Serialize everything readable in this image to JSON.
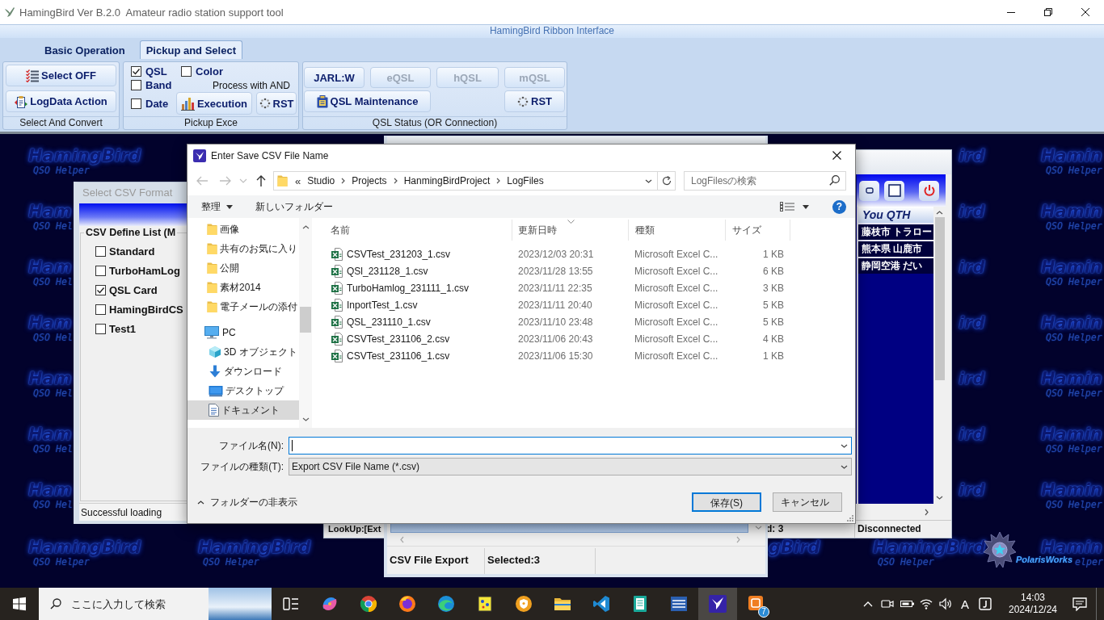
{
  "app_window": {
    "title": "HamingBird Ver B.2.0  Amateur radio station support tool"
  },
  "ribbon": {
    "caption": "HamingBird Ribbon Interface",
    "tabs": [
      {
        "label": "Basic Operation",
        "selected": false
      },
      {
        "label": "Pickup and Select",
        "selected": true
      }
    ],
    "groups": [
      {
        "label": "Select And Convert",
        "buttons": [
          {
            "label": "Select OFF"
          },
          {
            "label": "LogData Action"
          }
        ]
      },
      {
        "label": "Pickup Exce",
        "checkboxes": [
          {
            "label": "QSL",
            "checked": true
          },
          {
            "label": "Band",
            "checked": false
          },
          {
            "label": "Date",
            "checked": false
          },
          {
            "label": "Color",
            "checked": false
          }
        ],
        "note": "Process with AND",
        "buttons": [
          {
            "label": "Execution"
          },
          {
            "label": "RST"
          }
        ]
      },
      {
        "label": "QSL Status (OR Connection)",
        "buttons": [
          {
            "label": "JARL:W",
            "disabled": false
          },
          {
            "label": "eQSL",
            "disabled": true
          },
          {
            "label": "hQSL",
            "disabled": true
          },
          {
            "label": "mQSL",
            "disabled": true
          },
          {
            "label": "QSL Maintenance",
            "disabled": false
          },
          {
            "label": "RST",
            "disabled": false
          }
        ]
      }
    ]
  },
  "desktop": {
    "tiles": [
      {
        "title": "HamingBird",
        "subtitle": "QSO Helper"
      },
      {
        "title": "ird"
      },
      {
        "title": "Hamin",
        "subtitle": "QSO Helper"
      },
      {
        "title": "Ham",
        "subtitle": "QSO Hel"
      },
      {
        "title": "ird"
      },
      {
        "title": "Hamin",
        "subtitle": "QSO Helper"
      },
      {
        "title": "Ham",
        "subtitle": "QSO Hel"
      },
      {
        "title": "ird"
      },
      {
        "title": "Hamin",
        "subtitle": "QSO Helper"
      },
      {
        "title": "Ham",
        "subtitle": "QSO Hel"
      },
      {
        "title": "ird"
      },
      {
        "title": "Hamin",
        "subtitle": "QSO Helper"
      },
      {
        "title": "Ham",
        "subtitle": "QSO Hel"
      },
      {
        "title": "ird"
      },
      {
        "title": "Hamin",
        "subtitle": "QSO Helper"
      },
      {
        "title": "Ham",
        "subtitle": "QSO Hel"
      },
      {
        "title": "ird"
      },
      {
        "title": "Hamin",
        "subtitle": "QSO Helper"
      },
      {
        "title": "Ham",
        "subtitle": "QSO Hel"
      },
      {
        "title": "ird"
      },
      {
        "title": "Hamin",
        "subtitle": "QSO Helper"
      },
      {
        "title": "HamingBird",
        "subtitle": "QSO Helper"
      },
      {
        "title": "HamingBird",
        "subtitle": "QSO Helper"
      },
      {
        "title": "gBird"
      },
      {
        "title": "HamingBird",
        "subtitle": "QSO Helper"
      },
      {
        "title": "Hamin",
        "subtitle": "elper"
      }
    ],
    "brand": "PolarisWorks"
  },
  "format_window": {
    "title": "Select CSV Format",
    "group_label": "CSV Define List (M",
    "formats": [
      {
        "label": "Standard",
        "checked": false
      },
      {
        "label": "TurboHamLog",
        "checked": false
      },
      {
        "label": "QSL Card",
        "checked": true
      },
      {
        "label": "HamingBirdCS",
        "checked": false
      },
      {
        "label": "Test1",
        "checked": false
      }
    ],
    "status": "Successful loading"
  },
  "station_window": {
    "column": "You QTH",
    "rows": [
      "藤枝市 トラロー",
      "熊本県 山鹿市",
      "静岡空港 だい"
    ],
    "status": [
      "LookUp:[Ext",
      "d: 3",
      "Disconnected"
    ]
  },
  "export_window": {
    "status": [
      "CSV File Export",
      "Selected:3"
    ]
  },
  "save_dialog": {
    "title": "Enter Save CSV File Name",
    "history_buttons": [
      {
        "disabled": true
      },
      {
        "disabled": true
      },
      {
        "disabled": true
      },
      {
        "disabled": false
      }
    ],
    "address": {
      "overflow": "«",
      "crumbs": [
        "Studio",
        "Projects",
        "HanmingBirdProject",
        "LogFiles"
      ]
    },
    "search": {
      "placeholder": "LogFilesの検索"
    },
    "toolbar": {
      "organize": "整理",
      "new_folder": "新しいフォルダー",
      "help": "?"
    },
    "nav": {
      "quick_items": [
        {
          "label": "画像",
          "selected": false
        },
        {
          "label": "共有のお気に入り",
          "selected": false
        },
        {
          "label": "公開",
          "selected": false
        },
        {
          "label": "素材2014",
          "selected": false
        },
        {
          "label": "電子メールの添付",
          "selected": false
        }
      ],
      "tree": [
        {
          "label": "PC",
          "selected": false,
          "children": [
            {
              "label": "3D オブジェクト",
              "selected": false
            },
            {
              "label": "ダウンロード",
              "selected": false
            },
            {
              "label": "デスクトップ",
              "selected": false
            },
            {
              "label": "ドキュメント",
              "selected": true
            }
          ]
        }
      ]
    },
    "files": {
      "columns": [
        {
          "label": "名前",
          "sorted": false
        },
        {
          "label": "更新日時",
          "sorted": true
        },
        {
          "label": "種類",
          "sorted": false
        },
        {
          "label": "サイズ",
          "sorted": false
        }
      ],
      "rows": [
        {
          "name": "CSVTest_231203_1.csv",
          "modified": "2023/12/03 20:31",
          "type": "Microsoft Excel C...",
          "size": "1 KB"
        },
        {
          "name": "QSl_231128_1.csv",
          "modified": "2023/11/28 13:55",
          "type": "Microsoft Excel C...",
          "size": "6 KB"
        },
        {
          "name": "TurboHamlog_231111_1.csv",
          "modified": "2023/11/11 22:35",
          "type": "Microsoft Excel C...",
          "size": "3 KB"
        },
        {
          "name": "InportTest_1.csv",
          "modified": "2023/11/11 20:40",
          "type": "Microsoft Excel C...",
          "size": "5 KB"
        },
        {
          "name": "QSL_231110_1.csv",
          "modified": "2023/11/10 23:48",
          "type": "Microsoft Excel C...",
          "size": "5 KB"
        },
        {
          "name": "CSVTest_231106_2.csv",
          "modified": "2023/11/06 20:43",
          "type": "Microsoft Excel C...",
          "size": "4 KB"
        },
        {
          "name": "CSVTest_231106_1.csv",
          "modified": "2023/11/06 15:30",
          "type": "Microsoft Excel C...",
          "size": "1 KB"
        }
      ]
    },
    "filename": {
      "label": "ファイル名(N):",
      "focused": true
    },
    "filetype": {
      "label": "ファイルの種類(T):",
      "value": "Export CSV File Name (*.csv)"
    },
    "hide_folders": "フォルダーの非表示",
    "buttons": [
      {
        "label": "保存(S)",
        "default": true
      },
      {
        "label": "キャンセル",
        "default": false
      }
    ]
  },
  "taskbar": {
    "search": {
      "placeholder": "ここに入力して検索"
    },
    "apps": [
      {
        "active": false
      },
      {
        "active": false
      },
      {
        "active": false
      },
      {
        "active": false
      },
      {
        "active": false
      },
      {
        "active": false
      },
      {
        "active": false
      },
      {
        "active": false
      },
      {
        "active": false
      },
      {
        "active": false
      },
      {
        "active": false
      },
      {
        "active": true
      },
      {
        "active": false,
        "badge": "7"
      }
    ],
    "tray": {
      "ime": "A",
      "time": "14:03",
      "date": "2024/12/24"
    }
  }
}
